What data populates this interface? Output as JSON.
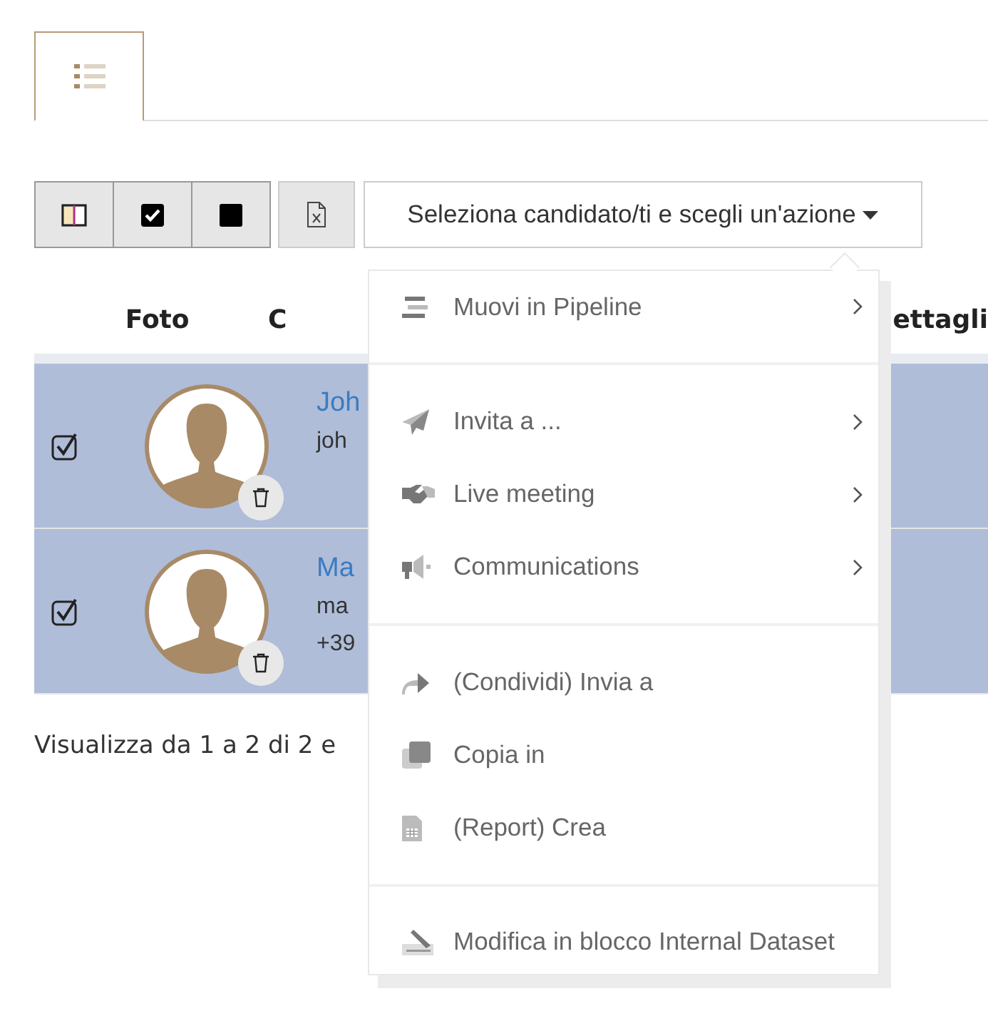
{
  "tabs": [
    {
      "selected": true
    }
  ],
  "toolbar": {
    "action_dropdown": "Seleziona candidato/ti e scegli un'azione"
  },
  "table": {
    "columns": [
      "Foto",
      "C",
      "ettagli"
    ],
    "rows": [
      {
        "selected": true,
        "checked": true,
        "name": "Joh",
        "lines": [
          "joh"
        ]
      },
      {
        "selected": true,
        "checked": true,
        "name": "Ma",
        "lines": [
          "ma",
          "+39"
        ]
      }
    ]
  },
  "footer": "Visualizza da 1 a 2 di 2 e",
  "menu": {
    "groups": [
      [
        {
          "label": "Muovi in Pipeline",
          "submenu": true
        }
      ],
      [
        {
          "label": "Invita a ...",
          "submenu": true
        },
        {
          "label": "Live meeting",
          "submenu": true
        },
        {
          "label": "Communications",
          "submenu": true
        }
      ],
      [
        {
          "label": "(Condividi) Invia a",
          "submenu": false
        },
        {
          "label": "Copia in",
          "submenu": false
        },
        {
          "label": "(Report) Crea",
          "submenu": false
        }
      ],
      [
        {
          "label": "Modifica in blocco Internal Dataset",
          "submenu": false
        }
      ]
    ]
  }
}
